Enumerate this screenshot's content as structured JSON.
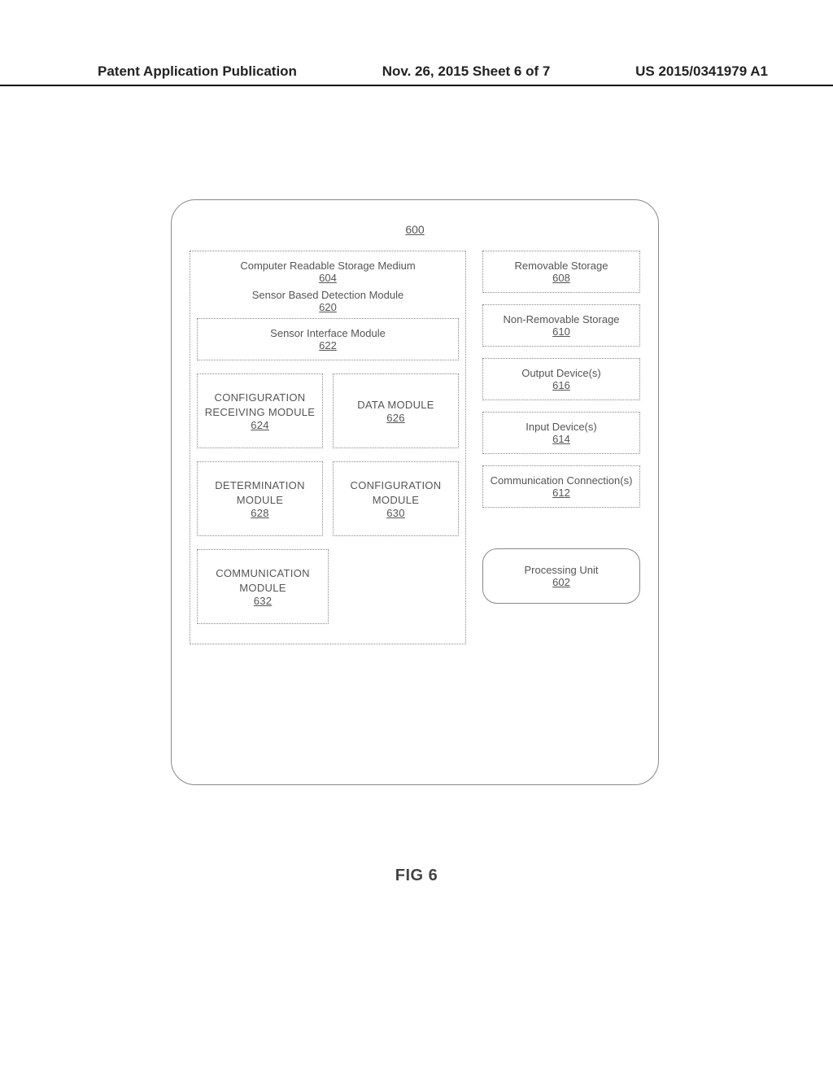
{
  "header": {
    "left": "Patent Application Publication",
    "center": "Nov. 26, 2015  Sheet 6 of 7",
    "right": "US 2015/0341979 A1"
  },
  "diagram": {
    "figure_label": "FIG 6",
    "outer_ref": "600",
    "storage_medium": {
      "label": "Computer Readable Storage Medium",
      "ref": "604"
    },
    "detection_module": {
      "label": "Sensor Based Detection Module",
      "ref": "620"
    },
    "sensor_interface": {
      "label": "Sensor Interface Module",
      "ref": "622"
    },
    "modules": {
      "config_recv": {
        "label": "CONFIGURATION RECEIVING MODULE",
        "ref": "624"
      },
      "data": {
        "label": "DATA MODULE",
        "ref": "626"
      },
      "determination": {
        "label": "DETERMINATION MODULE",
        "ref": "628"
      },
      "config": {
        "label": "CONFIGURATION MODULE",
        "ref": "630"
      },
      "comm": {
        "label": "COMMUNICATION MODULE",
        "ref": "632"
      }
    },
    "right": {
      "removable": {
        "label": "Removable Storage",
        "ref": "608"
      },
      "nonremovable": {
        "label": "Non-Removable Storage",
        "ref": "610"
      },
      "output": {
        "label": "Output Device(s)",
        "ref": "616"
      },
      "input": {
        "label": "Input Device(s)",
        "ref": "614"
      },
      "commconn": {
        "label": "Communication Connection(s)",
        "ref": "612"
      },
      "proc": {
        "label": "Processing Unit",
        "ref": "602"
      }
    }
  }
}
